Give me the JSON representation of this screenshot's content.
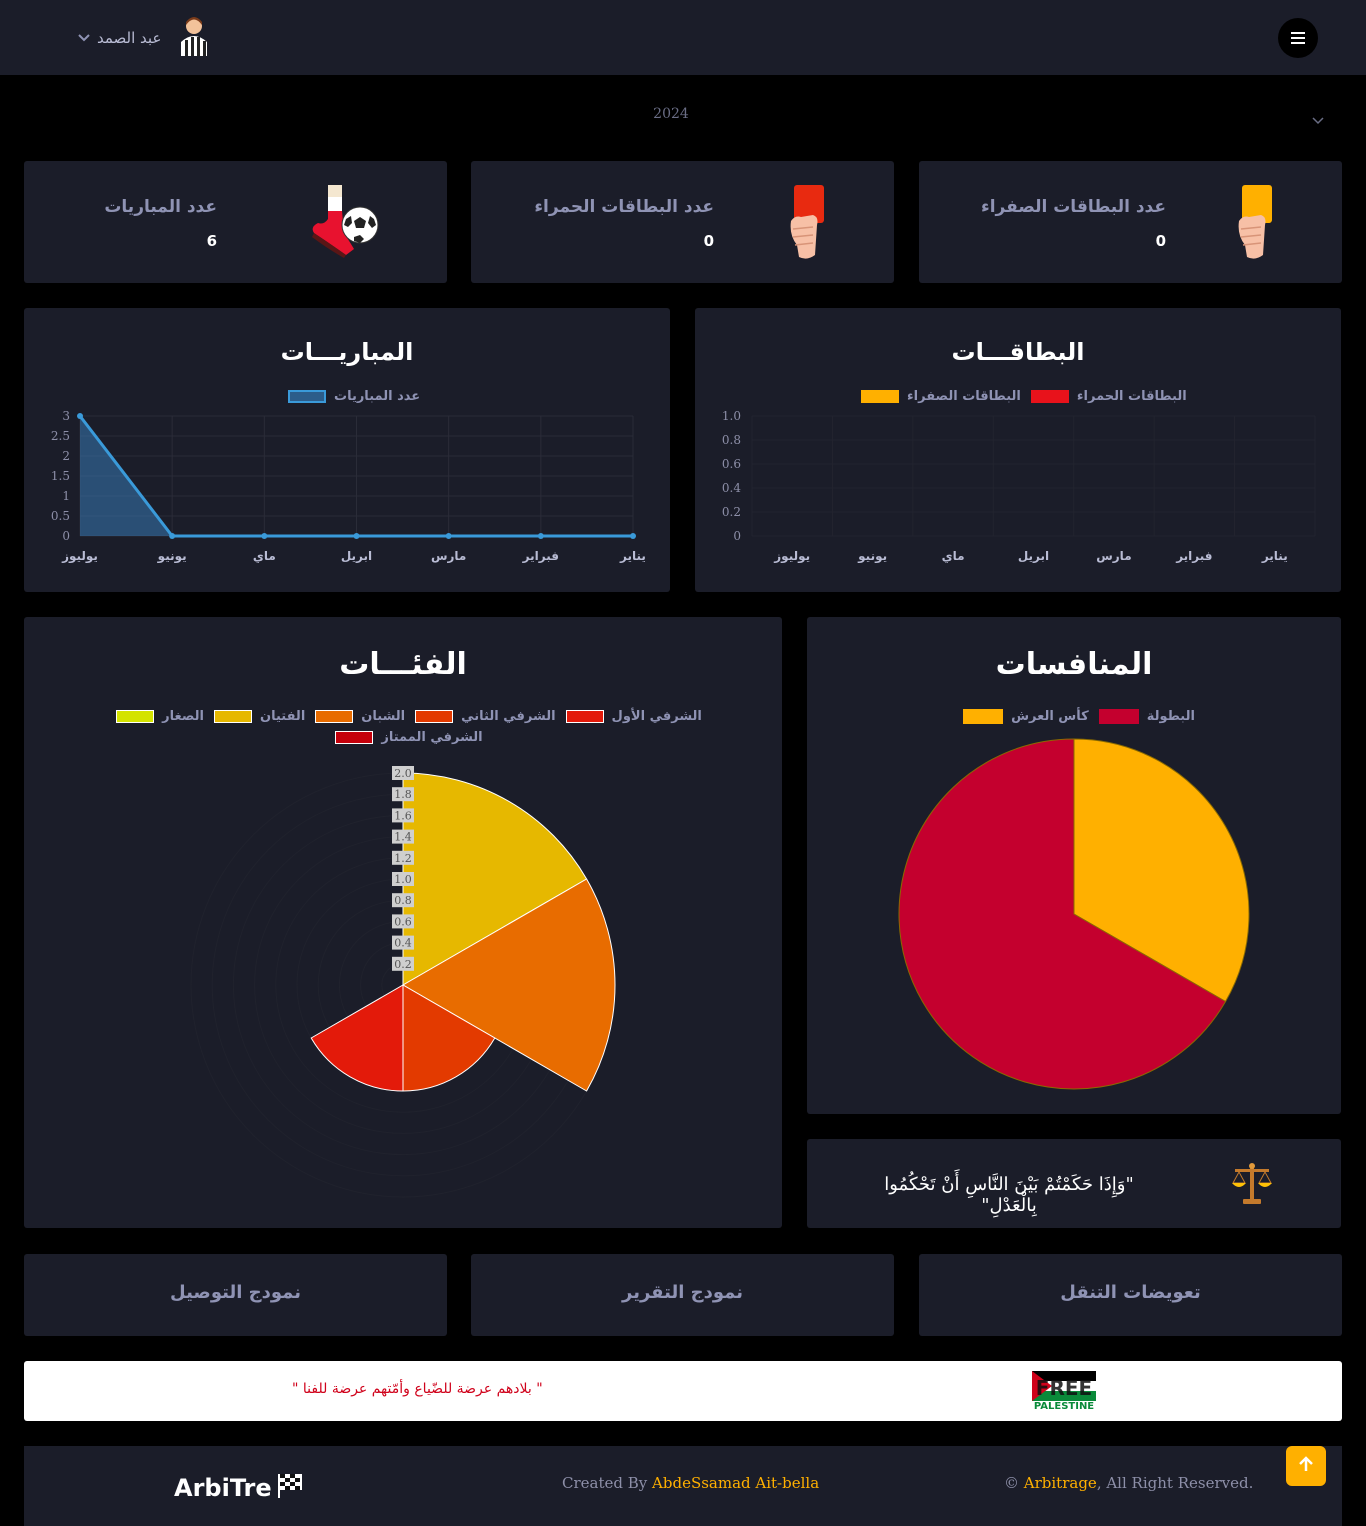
{
  "header": {
    "user_name": "عبد الصمد",
    "menu_icon": "hamburger-icon",
    "avatar_icon": "referee-avatar-icon"
  },
  "year_select": {
    "value": "2024"
  },
  "stats": {
    "matches": {
      "label": "عدد المباريات",
      "value": "6",
      "icon": "soccer-ball-icon"
    },
    "red_cards": {
      "label": "عدد البطاقات الحمراء",
      "value": "0",
      "icon": "red-card-icon"
    },
    "yellow_cards": {
      "label": "عدد البطاقات الصفراء",
      "value": "0",
      "icon": "yellow-card-icon"
    }
  },
  "matches_chart": {
    "title": "المباريـــات",
    "legend": "عدد المباريات"
  },
  "cards_chart": {
    "title": "البطاقـــات",
    "legend_red": "البطاقات الحمراء",
    "legend_yellow": "البطاقات الصفراء"
  },
  "categories_chart": {
    "title": "الفئـــات",
    "legend": [
      "الشرفي الأول",
      "الشرفي الثاني",
      "الشبان",
      "الفتيان",
      "الصغار",
      "الشرفي الممتاز"
    ]
  },
  "competitions_chart": {
    "title": "المنافسات",
    "legend": [
      "البطولة",
      "كأس العرش"
    ]
  },
  "quote": {
    "text": "\"وَإِذَا حَكَمْتُمْ بَيْنَ النَّاسِ أَنْ تَحْكُمُوا بِالْعَدْلِ\"",
    "icon": "scales-icon"
  },
  "links": {
    "travel": "تعويضات التنقل",
    "report": "نمودج التقرير",
    "receipt": "نمودج التوصيل"
  },
  "banner": {
    "logo_text": "FREE PALESTINE",
    "message": "\" بلادهم عرضة للضّياع وأمّتهم عرضة للفنا \""
  },
  "footer": {
    "brand": "ArbiTre",
    "created_prefix": "Created By",
    "created_name": "AbdeSsamad Ait-bella",
    "copy_symbol": "©",
    "copy_name": "Arbitrage",
    "copy_suffix": ", All Right Reserved."
  },
  "colors": {
    "card_bg": "#1b1d29",
    "accent": "#ffb000",
    "red": "#e8121b",
    "line_blue": "#3a9ad9"
  },
  "chart_data": [
    {
      "type": "area",
      "title": "المباريـــات",
      "categories": [
        "يوليوز",
        "يونيو",
        "ماي",
        "ابريل",
        "مارس",
        "فبراير",
        "يناير"
      ],
      "series": [
        {
          "name": "عدد المباريات",
          "values": [
            3,
            0,
            0,
            0,
            0,
            0,
            0
          ]
        }
      ],
      "yticks": [
        "0",
        "0.5",
        "1",
        "1.5",
        "2",
        "2.5",
        "3"
      ],
      "ylim": [
        0,
        3
      ]
    },
    {
      "type": "bar",
      "title": "البطاقـــات",
      "categories": [
        "يوليوز",
        "يونيو",
        "ماي",
        "ابريل",
        "مارس",
        "فبراير",
        "يناير"
      ],
      "series": [
        {
          "name": "البطاقات الحمراء",
          "values": [
            0,
            0,
            0,
            0,
            0,
            0,
            0
          ]
        },
        {
          "name": "البطاقات الصفراء",
          "values": [
            0,
            0,
            0,
            0,
            0,
            0,
            0
          ]
        }
      ],
      "yticks": [
        "0",
        "0.2",
        "0.4",
        "0.6",
        "0.8",
        "1.0"
      ],
      "ylim": [
        0,
        1
      ]
    },
    {
      "type": "polar-area",
      "title": "الفئـــات",
      "categories": [
        "الفتيان",
        "الشبان",
        "الشرفي الثاني",
        "الشرفي الأول",
        "الصغار",
        "الشرفي الممتاز"
      ],
      "values": [
        2,
        2,
        1,
        1,
        0,
        0
      ],
      "colors": [
        "#e6b800",
        "#e86c00",
        "#e33a00",
        "#e31a0a",
        "#d4e300",
        "#c4000b"
      ],
      "rticks": [
        "0.2",
        "0.4",
        "0.6",
        "0.8",
        "1.0",
        "1.2",
        "1.4",
        "1.6",
        "1.8",
        "2.0"
      ],
      "rlim": [
        0,
        2
      ]
    },
    {
      "type": "pie",
      "title": "المنافسات",
      "categories": [
        "كأس العرش",
        "البطولة"
      ],
      "values": [
        2,
        4
      ],
      "colors": [
        "#ffb000",
        "#c4002e"
      ]
    }
  ]
}
